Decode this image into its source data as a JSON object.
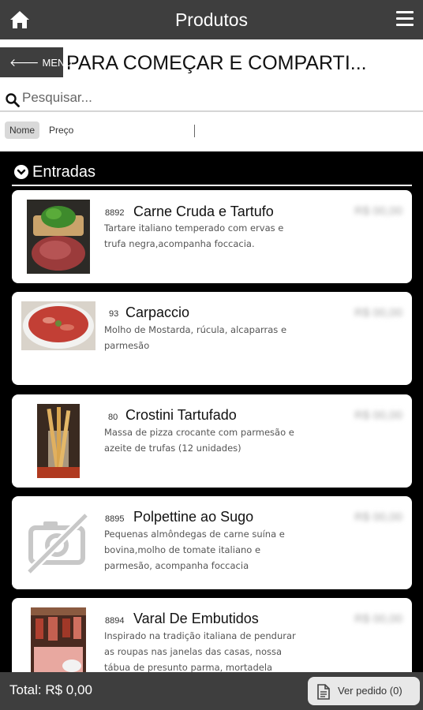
{
  "header": {
    "title": "Produtos",
    "home_icon": "home-icon",
    "menu_icon": "hamburger-menu-icon"
  },
  "category": {
    "title": "PARA COMEÇAR E COMPARTI...",
    "back_label": "MENU"
  },
  "search": {
    "placeholder": "Pesquisar..."
  },
  "sort": {
    "nome": "Nome",
    "preco": "Preço"
  },
  "section": {
    "label": "Entradas"
  },
  "products": [
    {
      "code": "8892",
      "name": "Carne Cruda e Tartufo",
      "desc": "Tartare italiano temperado com ervas e trufa negra,acompanha foccacia.",
      "price": "R$ 00,00"
    },
    {
      "code": "93",
      "name": "Carpaccio",
      "desc": "Molho de Mostarda, rúcula, alcaparras e parmesão",
      "price": "R$ 00,00"
    },
    {
      "code": "80",
      "name": "Crostini Tartufado",
      "desc": "Massa de pizza crocante com parmesão e azeite de trufas (12 unidades)",
      "price": "R$ 00,00"
    },
    {
      "code": "8895",
      "name": "Polpettine ao Sugo",
      "desc": "Pequenas almôndegas de carne suína e bovina,molho de tomate italiano e parmesão, acompanha foccacia",
      "price": "R$ 00,00"
    },
    {
      "code": "8894",
      "name": "Varal De Embutidos",
      "desc": "Inspirado na tradição italiana de pendurar as roupas nas janelas das casas, nossa tábua de presunto parma, mortadela",
      "price": "R$ 00,00"
    }
  ],
  "footer": {
    "total": "Total: R$ 0,00",
    "order_button": "Ver pedido (0)"
  },
  "colors": {
    "bar": "#3e3e3e",
    "list_bg": "#000000",
    "card_bg": "#ffffff"
  }
}
